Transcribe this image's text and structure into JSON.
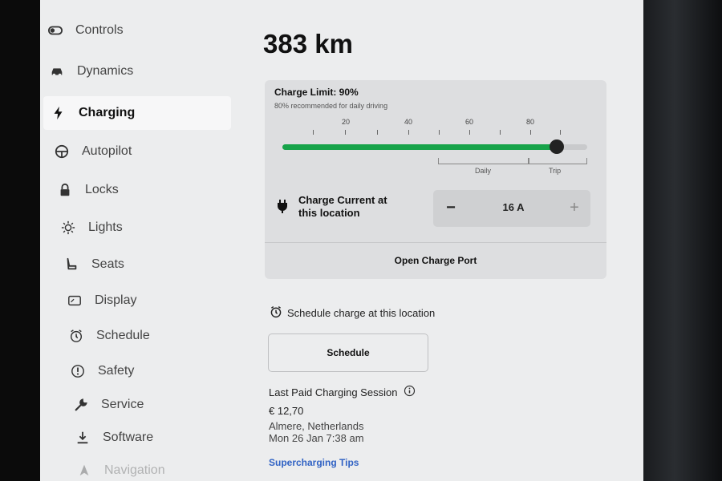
{
  "sidebar": {
    "items": [
      {
        "label": "Controls",
        "icon": "toggle-icon"
      },
      {
        "label": "Dynamics",
        "icon": "car-icon"
      },
      {
        "label": "Charging",
        "icon": "lightning-icon",
        "active": true
      },
      {
        "label": "Autopilot",
        "icon": "steering-wheel-icon"
      },
      {
        "label": "Locks",
        "icon": "lock-icon"
      },
      {
        "label": "Lights",
        "icon": "sun-icon"
      },
      {
        "label": "Seats",
        "icon": "seat-icon"
      },
      {
        "label": "Display",
        "icon": "display-icon"
      },
      {
        "label": "Schedule",
        "icon": "alarm-clock-icon"
      },
      {
        "label": "Safety",
        "icon": "warning-circle-icon"
      },
      {
        "label": "Service",
        "icon": "wrench-icon"
      },
      {
        "label": "Software",
        "icon": "download-icon"
      },
      {
        "label": "Navigation",
        "icon": "navigation-arrow-icon"
      }
    ]
  },
  "main": {
    "range": "383 km",
    "charge_limit": {
      "title": "Charge Limit: 90%",
      "subtitle": "80% recommended for daily driving",
      "value_percent": 90,
      "ticks": [
        "20",
        "40",
        "60",
        "80"
      ],
      "daily_label": "Daily",
      "trip_label": "Trip"
    },
    "charge_current": {
      "label_line1": "Charge Current at",
      "label_line2": "this location",
      "value": "16 A",
      "minus": "−",
      "plus": "+"
    },
    "open_port_label": "Open Charge Port",
    "schedule_label": "Schedule charge at this location",
    "schedule_button": "Schedule",
    "session": {
      "title": "Last Paid Charging Session",
      "amount": "€ 12,70",
      "location": "Almere, Netherlands",
      "time": "Mon 26 Jan 7:38 am"
    },
    "tips_link": "Supercharging Tips"
  },
  "colors": {
    "accent_green": "#17a34a",
    "link_blue": "#3062c4",
    "screen_bg": "#ecedee"
  }
}
